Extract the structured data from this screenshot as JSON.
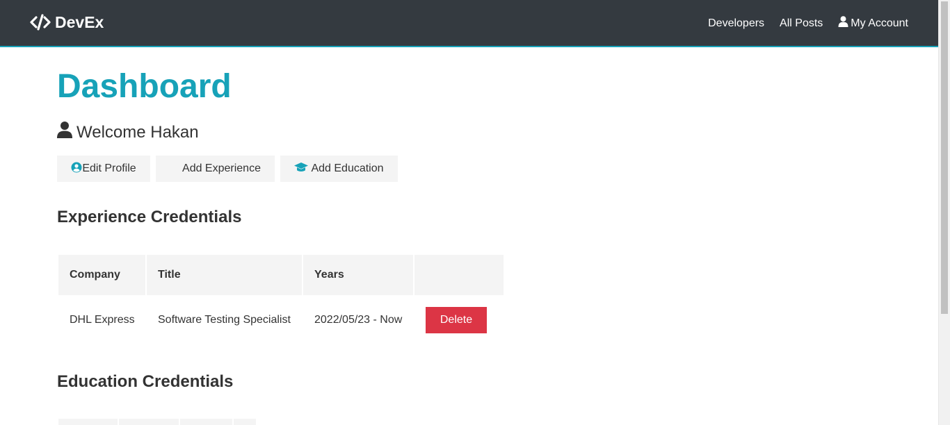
{
  "navbar": {
    "brand": "DevEx",
    "links": [
      {
        "label": "Developers"
      },
      {
        "label": "All Posts"
      },
      {
        "label": "My Account",
        "icon": "user-icon"
      }
    ]
  },
  "main": {
    "title": "Dashboard",
    "welcome": "Welcome Hakan",
    "actions": [
      {
        "label": "Edit Profile",
        "icon": "user-circle-icon"
      },
      {
        "label": "Add Experience",
        "icon": "briefcase-icon"
      },
      {
        "label": "Add Education",
        "icon": "graduation-cap-icon"
      }
    ],
    "experience": {
      "heading": "Experience Credentials",
      "columns": [
        "Company",
        "Title",
        "Years",
        ""
      ],
      "rows": [
        {
          "company": "DHL Express",
          "title": "Software Testing Specialist",
          "years": "2022/05/23 - Now",
          "action": "Delete"
        }
      ]
    },
    "education": {
      "heading": "Education Credentials"
    }
  },
  "colors": {
    "primary": "#17a2b8",
    "dark": "#343a40",
    "light": "#f4f4f4",
    "danger": "#dc3545"
  }
}
